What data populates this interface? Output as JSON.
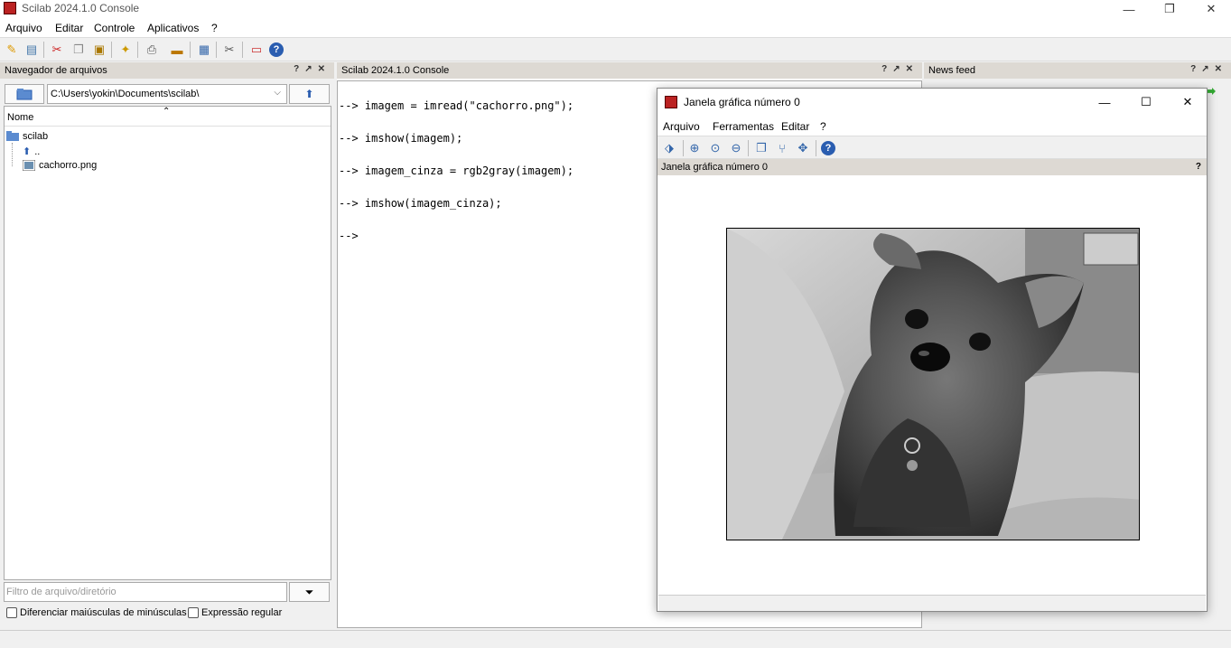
{
  "window": {
    "title": "Scilab 2024.1.0 Console"
  },
  "menubar": {
    "items": [
      "Arquivo",
      "Editar",
      "Controle",
      "Aplicativos",
      "?"
    ]
  },
  "file_browser": {
    "header": "Navegador de arquivos",
    "path": "C:\\Users\\yokin\\Documents\\scilab\\",
    "column_name": "Nome",
    "tree": {
      "root": "scilab",
      "parent": "..",
      "file": "cachorro.png"
    },
    "filter_placeholder": "Filtro de arquivo/diretório",
    "checkbox_case": "Diferenciar maiúsculas de minúsculas",
    "checkbox_regex": "Expressão regular"
  },
  "console": {
    "header": "Scilab 2024.1.0 Console",
    "lines": [
      "--> imagem = imread(\"cachorro.png\");",
      "--> imshow(imagem);",
      "--> imagem_cinza = rgb2gray(imagem);",
      "--> imshow(imagem_cinza);",
      "-->"
    ]
  },
  "news_feed": {
    "header": "News feed"
  },
  "graphic_window": {
    "title": "Janela gráfica número 0",
    "menu": [
      "Arquivo",
      "Ferramentas",
      "Editar",
      "?"
    ],
    "panel_title": "Janela gráfica número 0"
  },
  "colors": {
    "panel_header": "#ddd9d3",
    "scilab_red": "#b22222"
  }
}
